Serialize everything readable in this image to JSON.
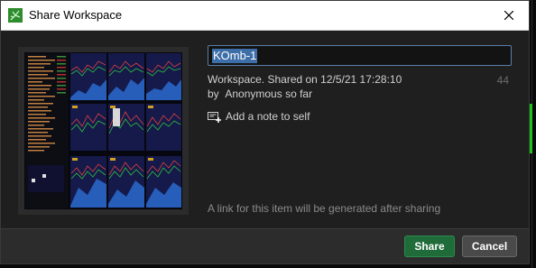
{
  "dialog": {
    "title": "Share Workspace",
    "icon": "workspace-leaf-icon",
    "close_icon": "close-icon"
  },
  "form": {
    "name_value": "KOmb-1",
    "char_count": "44",
    "meta_line": "Workspace. Shared on 12/5/21 17:28:10",
    "by_label": "by",
    "by_value": "Anonymous so far",
    "add_note_label": "Add a note to self",
    "link_note": "A link for this item will be generated after sharing"
  },
  "footer": {
    "share_label": "Share",
    "cancel_label": "Cancel"
  },
  "colors": {
    "accent": "#1f6b3a",
    "input_border": "#5a7fa6",
    "selection": "#3d6ea8"
  }
}
